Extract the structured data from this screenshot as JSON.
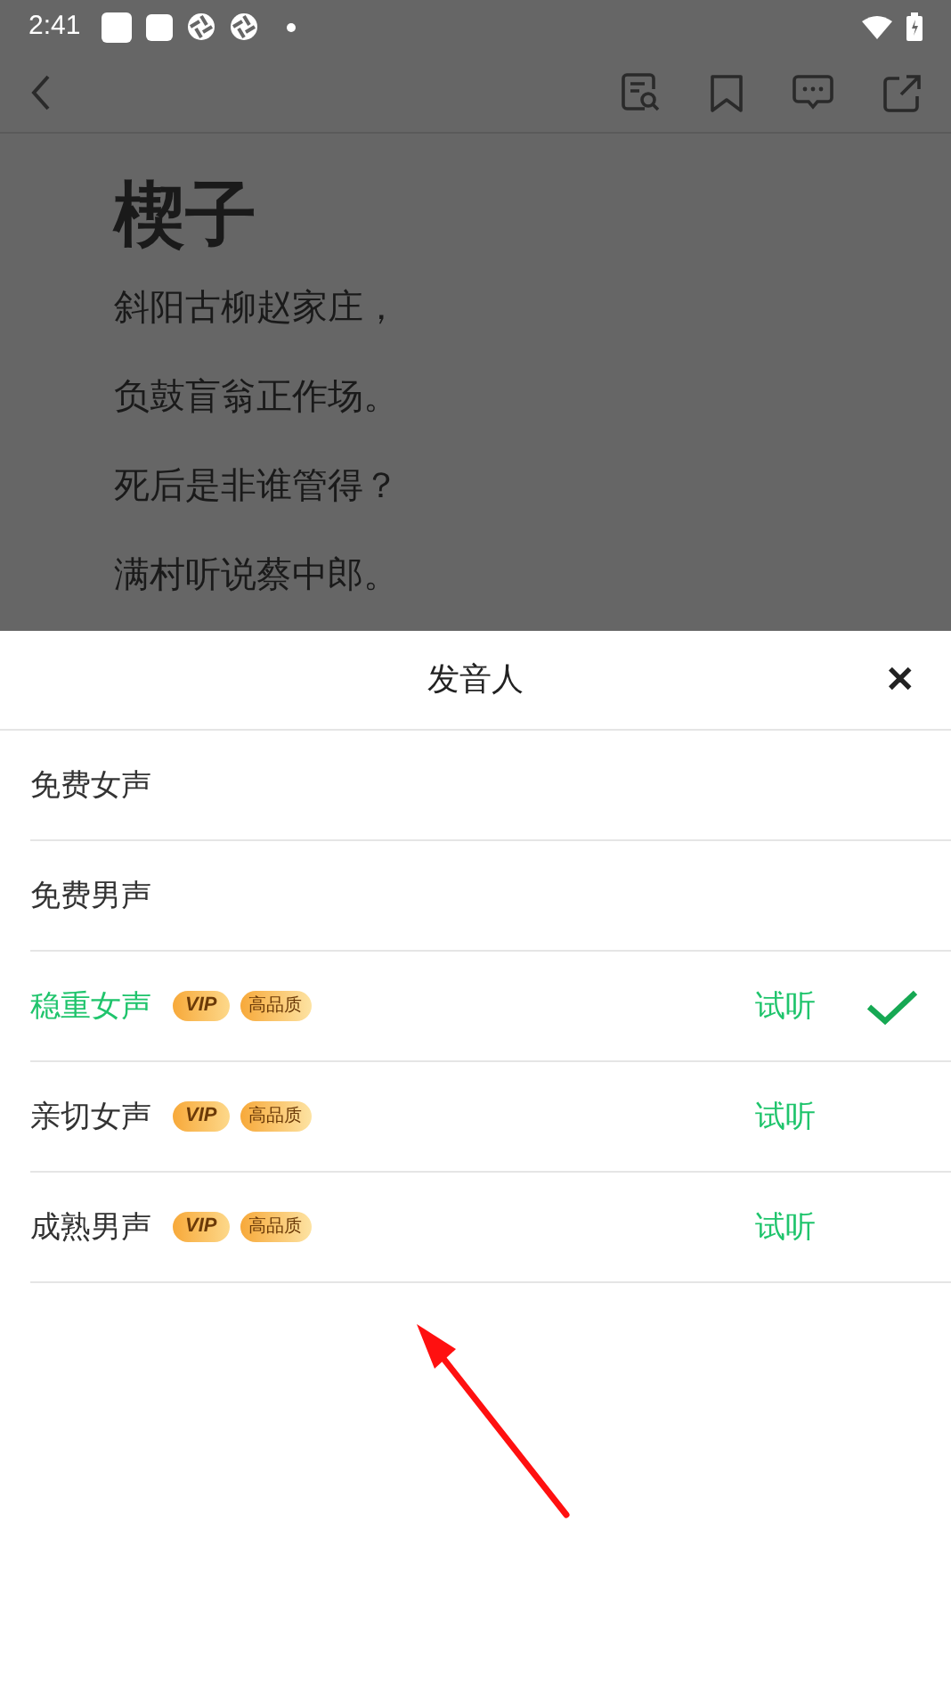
{
  "status_bar": {
    "time": "2:41"
  },
  "article": {
    "title": "楔子",
    "lines": [
      "斜阳古柳赵家庄，",
      "负鼓盲翁正作场。",
      "死后是非谁管得？",
      "满村听说蔡中郎。"
    ]
  },
  "sheet": {
    "title": "发音人",
    "close": "✕",
    "voices": [
      {
        "name": "免费女声",
        "selected": false
      },
      {
        "name": "免费男声",
        "selected": false
      },
      {
        "name": "稳重女声",
        "badges": [
          "VIP",
          "高品质"
        ],
        "preview": "试听",
        "selected": true
      },
      {
        "name": "亲切女声",
        "badges": [
          "VIP",
          "高品质"
        ],
        "preview": "试听",
        "selected": false
      },
      {
        "name": "成熟男声",
        "badges": [
          "VIP",
          "高品质"
        ],
        "preview": "试听",
        "selected": false
      }
    ]
  }
}
